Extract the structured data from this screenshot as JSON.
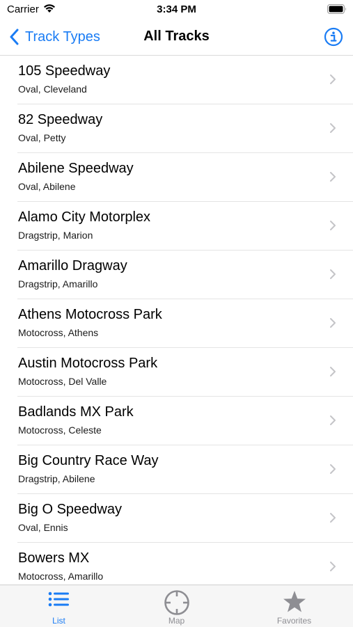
{
  "status_bar": {
    "carrier": "Carrier",
    "time": "3:34 PM"
  },
  "nav": {
    "back_label": "Track Types",
    "title": "All Tracks"
  },
  "tracks": [
    {
      "name": "105 Speedway",
      "detail": "Oval, Cleveland"
    },
    {
      "name": "82 Speedway",
      "detail": "Oval, Petty"
    },
    {
      "name": "Abilene Speedway",
      "detail": "Oval, Abilene"
    },
    {
      "name": "Alamo City Motorplex",
      "detail": "Dragstrip, Marion"
    },
    {
      "name": "Amarillo Dragway",
      "detail": "Dragstrip, Amarillo"
    },
    {
      "name": "Athens Motocross Park",
      "detail": "Motocross, Athens"
    },
    {
      "name": "Austin Motocross Park",
      "detail": "Motocross, Del Valle"
    },
    {
      "name": "Badlands MX Park",
      "detail": "Motocross, Celeste"
    },
    {
      "name": "Big Country Race Way",
      "detail": "Dragstrip, Abilene"
    },
    {
      "name": "Big O Speedway",
      "detail": "Oval, Ennis"
    },
    {
      "name": "Bowers MX",
      "detail": "Motocross, Amarillo"
    }
  ],
  "tabs": [
    {
      "label": "List",
      "icon": "list-icon",
      "active": true
    },
    {
      "label": "Map",
      "icon": "crosshair-icon",
      "active": false
    },
    {
      "label": "Favorites",
      "icon": "star-icon",
      "active": false
    }
  ],
  "colors": {
    "accent": "#1a7cf4",
    "inactive": "#8e8e93"
  }
}
